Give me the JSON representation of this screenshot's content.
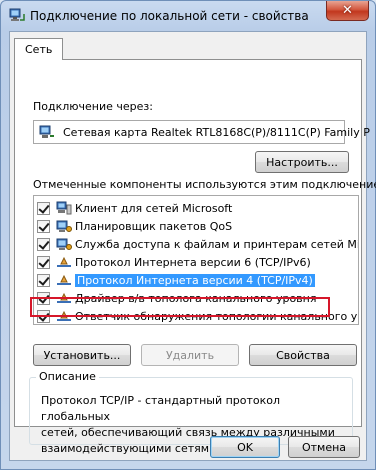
{
  "window": {
    "title": "Подключение по локальной сети - свойства",
    "close_glyph": "✕"
  },
  "tabs": [
    {
      "label": "Сеть",
      "selected": true
    }
  ],
  "connect_using": {
    "label": "Подключение через:",
    "adapter": "Сетевая карта Realtek RTL8168C(P)/8111C(P) Family P",
    "configure_button": "Настроить..."
  },
  "components": {
    "label": "Отмеченные компоненты используются этим подключением:",
    "items": [
      {
        "label": "Клиент для сетей Microsoft",
        "checked": true,
        "icon": "network-client-icon"
      },
      {
        "label": "Планировщик пакетов QoS",
        "checked": true,
        "icon": "service-icon"
      },
      {
        "label": "Служба доступа к файлам и принтерам сетей Micro...",
        "checked": true,
        "icon": "service-icon"
      },
      {
        "label": "Протокол Интернета версии 6 (TCP/IPv6)",
        "checked": true,
        "icon": "protocol-icon"
      },
      {
        "label": "Протокол Интернета версии 4 (TCP/IPv4)",
        "checked": true,
        "icon": "protocol-icon",
        "selected": true
      },
      {
        "label": "Драйвер в/в тополога канального уровня",
        "checked": true,
        "icon": "protocol-icon"
      },
      {
        "label": "Ответчик обнаружения топологии канального уровня",
        "checked": true,
        "icon": "protocol-icon"
      }
    ]
  },
  "actions": {
    "install": "Установить...",
    "remove": "Удалить",
    "properties": "Свойства"
  },
  "description": {
    "legend": "Описание",
    "lines": [
      "Протокол TCP/IP - стандартный протокол глобальных",
      "сетей, обеспечивающий связь между различными",
      "взаимодействующими сетями."
    ]
  },
  "footer": {
    "ok": "OK",
    "cancel": "Отмена"
  },
  "colors": {
    "selection": "#3399ff",
    "highlight_frame": "#d6172a"
  }
}
